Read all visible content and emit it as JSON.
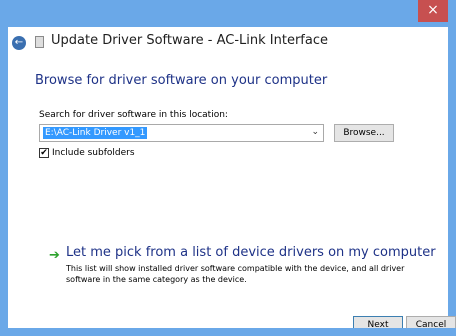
{
  "window": {
    "title": "Update Driver Software - AC-Link Interface",
    "close_glyph": "×"
  },
  "header": {
    "back_glyph": "←"
  },
  "main": {
    "heading": "Browse for driver software on your computer",
    "search_label": "Search for driver software in this location:",
    "path_value": "E:\\AC-Link Driver v1_1",
    "combo_arrow": "⌄",
    "browse_label": "Browse...",
    "include_checkbox_glyph": "✔",
    "include_subfolders_label": "Include subfolders",
    "include_subfolders_checked": true
  },
  "pick_option": {
    "arrow_glyph": "➔",
    "title": "Let me pick from a list of device drivers on my computer",
    "description": "This list will show installed driver software compatible with the device, and all driver software in the same category as the device."
  },
  "footer": {
    "next_label": "Next",
    "cancel_label": "Cancel"
  },
  "colors": {
    "frame": "#6aa8e8",
    "close": "#c75050",
    "heading": "#1e3287",
    "selection": "#3399ff",
    "arrow_green": "#2ca22c"
  }
}
